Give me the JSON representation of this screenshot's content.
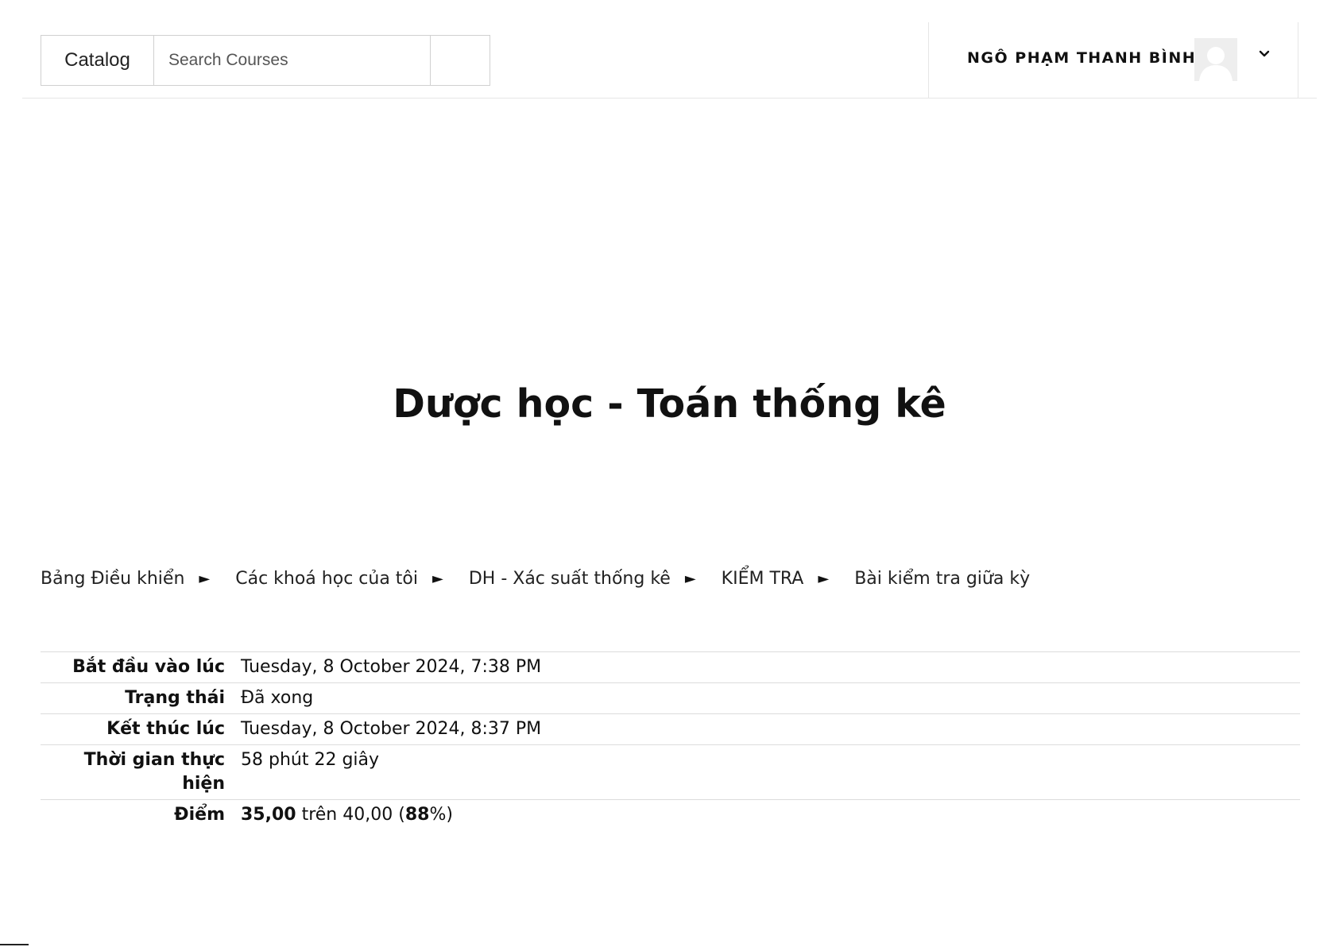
{
  "header": {
    "catalog_label": "Catalog",
    "search_placeholder": "Search Courses",
    "user_name": "NGÔ PHẠM THANH BÌNH"
  },
  "page_title": "Dược học - Toán thống kê",
  "breadcrumb": [
    "Bảng Điều khiển",
    "Các khoá học của tôi",
    "DH - Xác suất thống kê",
    "KIỂM TRA",
    "Bài kiểm tra giữa kỳ"
  ],
  "breadcrumb_separator": "►",
  "summary": {
    "started_label": "Bắt đầu vào lúc",
    "started_value": "Tuesday, 8 October 2024, 7:38 PM",
    "state_label": "Trạng thái",
    "state_value": "Đã xong",
    "completed_label": "Kết thúc lúc",
    "completed_value": "Tuesday, 8 October 2024, 8:37 PM",
    "time_label": "Thời gian thực hiện",
    "time_value": "58 phút 22 giây",
    "grade_label": "Điểm",
    "grade_score": "35,00",
    "grade_mid": " trên 40,00 (",
    "grade_percent": "88",
    "grade_end": "%)"
  }
}
